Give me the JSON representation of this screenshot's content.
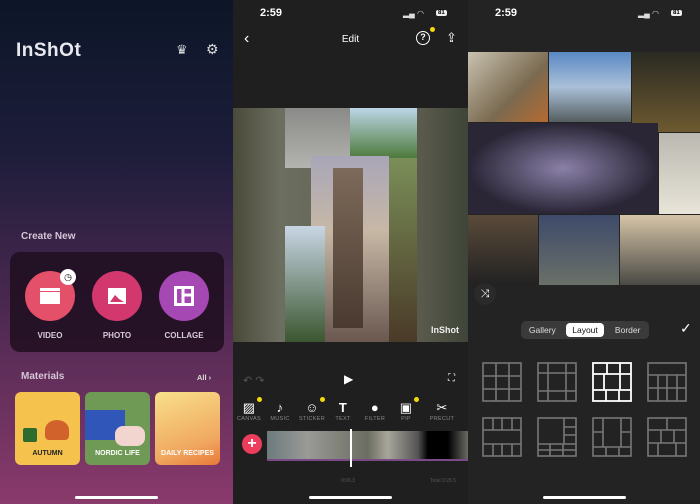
{
  "home": {
    "logo": "InShOt",
    "create_new": "Create New",
    "buttons": [
      {
        "label": "VIDEO",
        "color": "#e4506a"
      },
      {
        "label": "PHOTO",
        "color": "#d2386e"
      },
      {
        "label": "COLLAGE",
        "color": "#a548b4"
      }
    ],
    "materials": "Materials",
    "all": "All ›",
    "tiles": [
      "AUTUMN",
      "NORDIC LIFE",
      "DAILY RECIPES"
    ]
  },
  "edit": {
    "time": "2:59",
    "battery": "81",
    "title": "Edit",
    "watermark": "InShot",
    "tools": [
      "CANVAS",
      "MUSIC",
      "STICKER",
      "TEXT",
      "FILTER",
      "PIP",
      "PRECUT"
    ],
    "current_time": "0:06.3",
    "total_time": "Total 0:28.5"
  },
  "collage": {
    "time": "2:59",
    "battery": "81",
    "tabs": [
      "Gallery",
      "Layout",
      "Border"
    ],
    "active_tab": "Layout"
  }
}
